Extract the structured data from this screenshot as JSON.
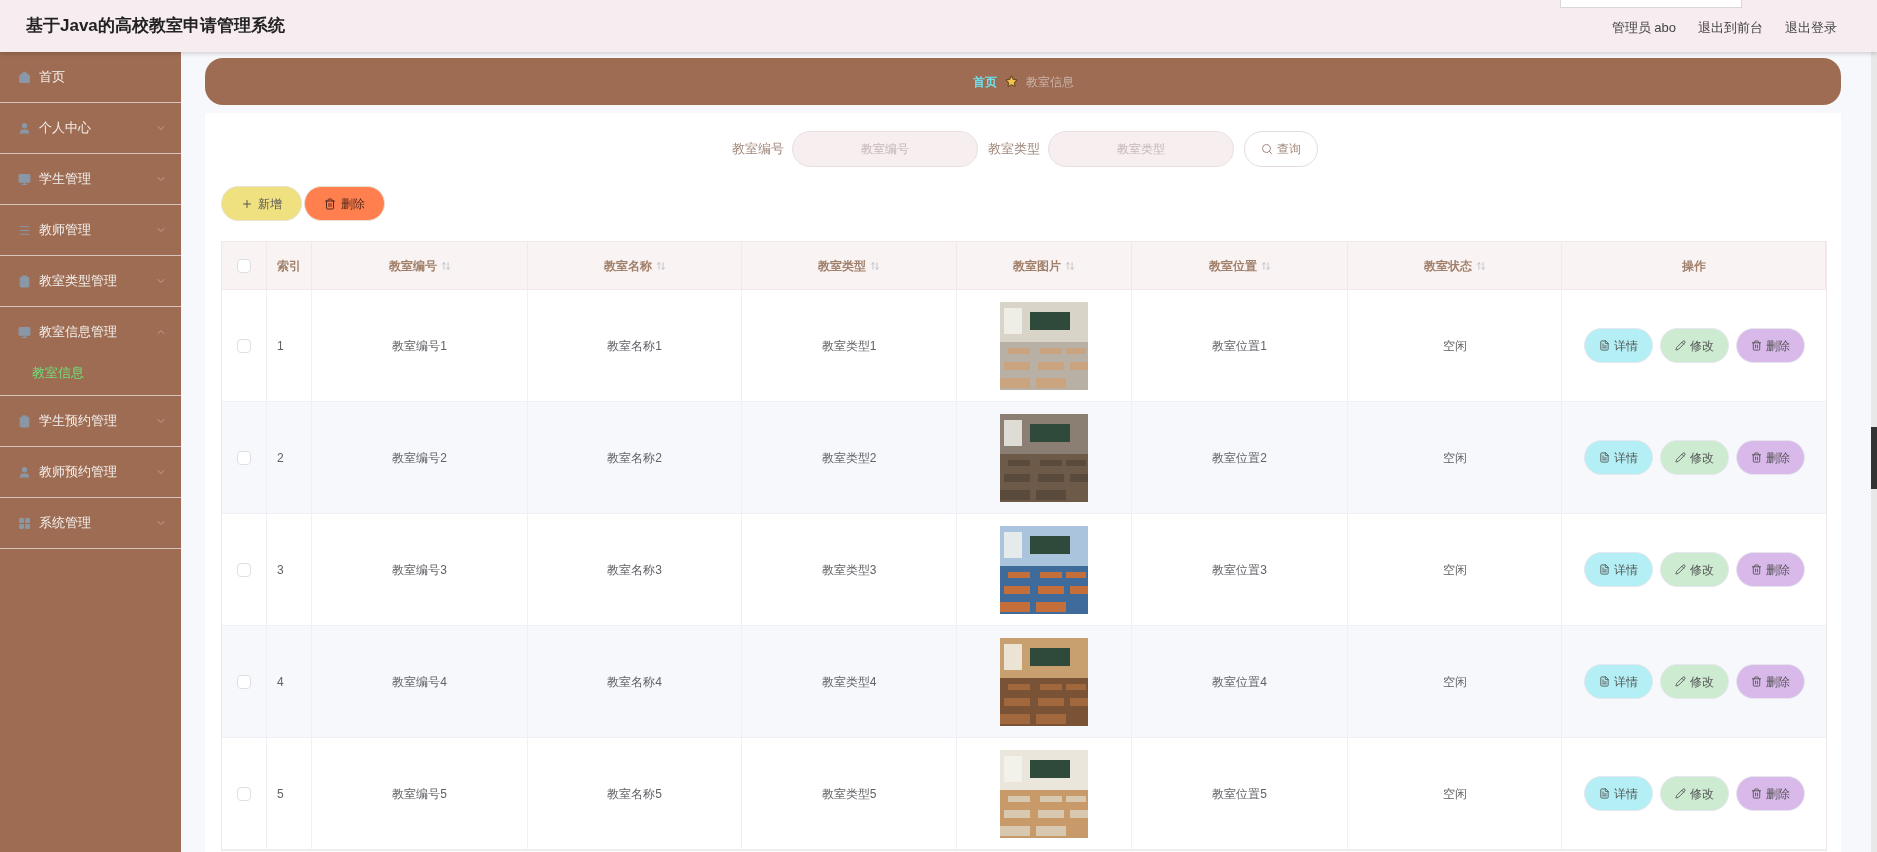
{
  "header": {
    "title": "基于Java的高校教室申请管理系统",
    "links": [
      "管理员 abo",
      "退出到前台",
      "退出登录"
    ]
  },
  "sidebar": {
    "items": [
      {
        "label": "首页",
        "expandable": false
      },
      {
        "label": "个人中心",
        "expandable": true,
        "expanded": false
      },
      {
        "label": "学生管理",
        "expandable": true,
        "expanded": false
      },
      {
        "label": "教师管理",
        "expandable": true,
        "expanded": false
      },
      {
        "label": "教室类型管理",
        "expandable": true,
        "expanded": false
      },
      {
        "label": "教室信息管理",
        "expandable": true,
        "expanded": true,
        "children": [
          {
            "label": "教室信息",
            "selected": true
          }
        ]
      },
      {
        "label": "学生预约管理",
        "expandable": true,
        "expanded": false
      },
      {
        "label": "教师预约管理",
        "expandable": true,
        "expanded": false
      },
      {
        "label": "系统管理",
        "expandable": true,
        "expanded": false
      }
    ]
  },
  "breadcrumb": [
    {
      "label": "首页",
      "kind": "link"
    },
    {
      "label": "教室信息",
      "kind": "current"
    }
  ],
  "search": {
    "fields": [
      {
        "label": "教室编号",
        "placeholder": "教室编号"
      },
      {
        "label": "教室类型",
        "placeholder": "教室类型"
      }
    ],
    "button": "查询"
  },
  "toolbar": [
    {
      "label": "新增",
      "kind": "add"
    },
    {
      "label": "删除",
      "kind": "delete"
    }
  ],
  "table": {
    "select_all_checked": false,
    "columns": [
      {
        "label": "索引",
        "sortable": false
      },
      {
        "label": "教室编号",
        "sortable": true
      },
      {
        "label": "教室名称",
        "sortable": true
      },
      {
        "label": "教室类型",
        "sortable": true
      },
      {
        "label": "教室图片",
        "sortable": true
      },
      {
        "label": "教室位置",
        "sortable": true
      },
      {
        "label": "教室状态",
        "sortable": true
      },
      {
        "label": "操作",
        "sortable": false
      }
    ],
    "rows": [
      {
        "checked": false,
        "cells": [
          "1",
          "教室编号1",
          "教室名称1",
          "教室类型1",
          {
            "kind": "picture"
          },
          "教室位置1",
          "空闲"
        ],
        "actions": [
          {
            "label": "详情",
            "kind": "detail"
          },
          {
            "label": "修改",
            "kind": "edit"
          },
          {
            "label": "删除",
            "kind": "delete"
          }
        ]
      },
      {
        "checked": false,
        "cells": [
          "2",
          "教室编号2",
          "教室名称2",
          "教室类型2",
          {
            "kind": "picture"
          },
          "教室位置2",
          "空闲"
        ],
        "actions": [
          {
            "label": "详情",
            "kind": "detail"
          },
          {
            "label": "修改",
            "kind": "edit"
          },
          {
            "label": "删除",
            "kind": "delete"
          }
        ]
      },
      {
        "checked": false,
        "cells": [
          "3",
          "教室编号3",
          "教室名称3",
          "教室类型3",
          {
            "kind": "picture"
          },
          "教室位置3",
          "空闲"
        ],
        "actions": [
          {
            "label": "详情",
            "kind": "detail"
          },
          {
            "label": "修改",
            "kind": "edit"
          },
          {
            "label": "删除",
            "kind": "delete"
          }
        ]
      },
      {
        "checked": false,
        "cells": [
          "4",
          "教室编号4",
          "教室名称4",
          "教室类型4",
          {
            "kind": "picture"
          },
          "教室位置4",
          "空闲"
        ],
        "actions": [
          {
            "label": "详情",
            "kind": "detail"
          },
          {
            "label": "修改",
            "kind": "edit"
          },
          {
            "label": "删除",
            "kind": "delete"
          }
        ]
      },
      {
        "checked": false,
        "cells": [
          "5",
          "教室编号5",
          "教室名称5",
          "教室类型5",
          {
            "kind": "picture"
          },
          "教室位置5",
          "空闲"
        ],
        "actions": [
          {
            "label": "详情",
            "kind": "detail"
          },
          {
            "label": "修改",
            "kind": "edit"
          },
          {
            "label": "删除",
            "kind": "delete"
          }
        ]
      }
    ]
  }
}
